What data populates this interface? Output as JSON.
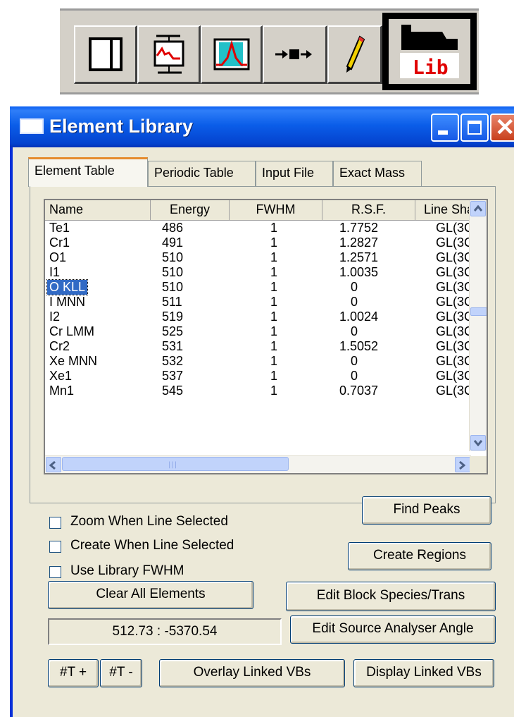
{
  "toolbar": {
    "buttons": [
      {
        "icon": "panel-window-icon"
      },
      {
        "icon": "spectrum-processing-icon"
      },
      {
        "icon": "peak-fit-icon"
      },
      {
        "icon": "move-block-icon"
      },
      {
        "icon": "pencil-icon"
      },
      {
        "icon": "library-icon",
        "label": "Lib",
        "selected": true
      }
    ]
  },
  "window": {
    "title": "Element Library",
    "tabs": [
      "Element Table",
      "Periodic Table",
      "Input File",
      "Exact Mass"
    ],
    "active_tab": "Element Table"
  },
  "table": {
    "columns": [
      "Name",
      "Energy",
      "FWHM",
      "R.S.F.",
      "Line Sha"
    ],
    "rows": [
      {
        "name": "Te1",
        "energy": "486",
        "fwhm": "1",
        "rsf": "1.7752",
        "line": "GL(3C"
      },
      {
        "name": "Cr1",
        "energy": "491",
        "fwhm": "1",
        "rsf": "1.2827",
        "line": "GL(3C"
      },
      {
        "name": "O1",
        "energy": "510",
        "fwhm": "1",
        "rsf": "1.2571",
        "line": "GL(3C"
      },
      {
        "name": "I1",
        "energy": "510",
        "fwhm": "1",
        "rsf": "1.0035",
        "line": "GL(3C"
      },
      {
        "name": "O KLL",
        "energy": "510",
        "fwhm": "1",
        "rsf": "0",
        "line": "GL(3C",
        "selected": true
      },
      {
        "name": "I MNN",
        "energy": "511",
        "fwhm": "1",
        "rsf": "0",
        "line": "GL(3C"
      },
      {
        "name": "I2",
        "energy": "519",
        "fwhm": "1",
        "rsf": "1.0024",
        "line": "GL(3C"
      },
      {
        "name": "Cr LMM",
        "energy": "525",
        "fwhm": "1",
        "rsf": "0",
        "line": "GL(3C"
      },
      {
        "name": "Cr2",
        "energy": "531",
        "fwhm": "1",
        "rsf": "1.5052",
        "line": "GL(3C"
      },
      {
        "name": "Xe MNN",
        "energy": "532",
        "fwhm": "1",
        "rsf": "0",
        "line": "GL(3C"
      },
      {
        "name": "Xe1",
        "energy": "537",
        "fwhm": "1",
        "rsf": "0",
        "line": "GL(3C"
      },
      {
        "name": "Mn1",
        "energy": "545",
        "fwhm": "1",
        "rsf": "0.7037",
        "line": "GL(3C"
      }
    ]
  },
  "options": {
    "zoom_when_selected": "Zoom When Line Selected",
    "create_when_selected": "Create When Line Selected",
    "use_library_fwhm": "Use Library FWHM"
  },
  "buttons": {
    "find_peaks": "Find Peaks",
    "create_regions": "Create Regions",
    "clear_all": "Clear All Elements",
    "edit_block": "Edit Block Species/Trans",
    "edit_source": "Edit Source Analyser Angle",
    "t_plus": "#T +",
    "t_minus": "#T -",
    "overlay_linked": "Overlay Linked VBs",
    "display_linked": "Display Linked VBs"
  },
  "readout": "512.73 : -5370.54",
  "colors": {
    "title_bar": "#0b5ee9",
    "selection": "#316ac5",
    "dialog_bg": "#ece9d8"
  }
}
